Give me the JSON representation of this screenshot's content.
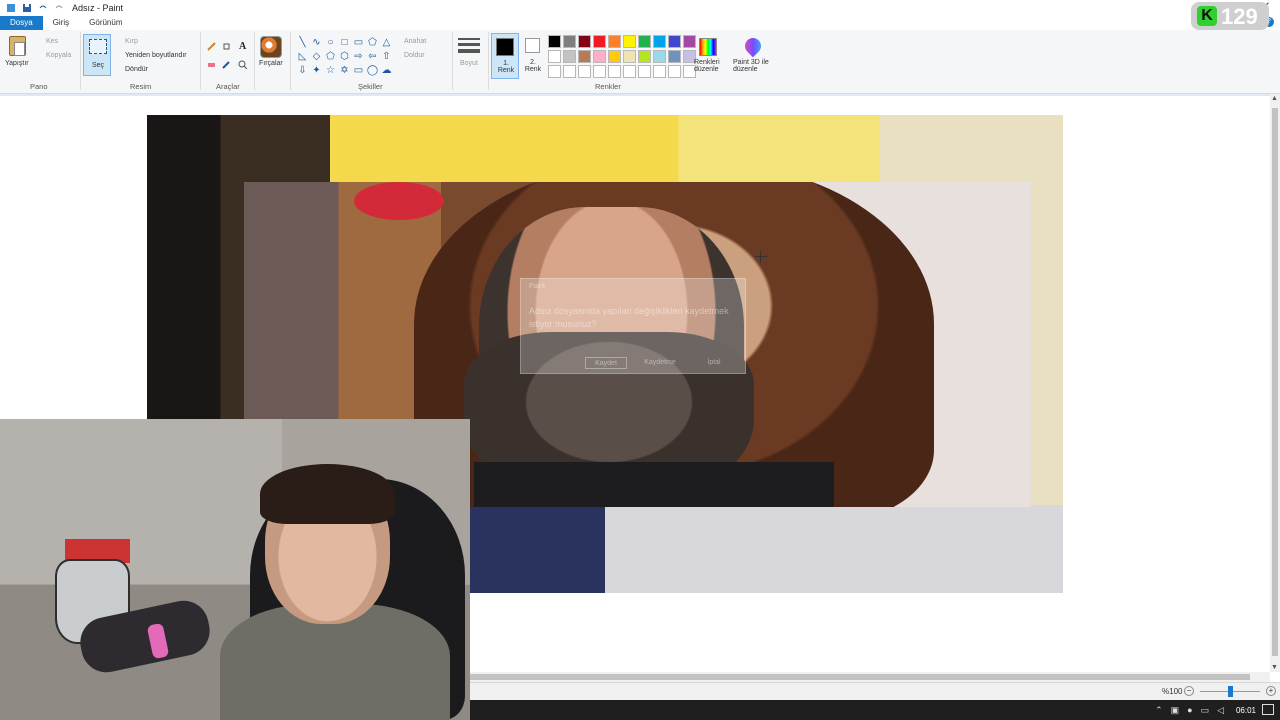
{
  "window": {
    "title": "Adsız - Paint"
  },
  "tabs": [
    {
      "label": "Dosya",
      "active": true
    },
    {
      "label": "Giriş",
      "active": false
    },
    {
      "label": "Görünüm",
      "active": false
    }
  ],
  "ribbon": {
    "clipboard": {
      "paste": "Yapıştır",
      "cut": "Kes",
      "copy": "Kopyala",
      "group": "Pano"
    },
    "image": {
      "select": "Seç",
      "crop": "Kırp",
      "resize": "Yeniden boyutlandır",
      "rotate": "Döndür",
      "group": "Resim"
    },
    "tools": {
      "group": "Araçlar"
    },
    "brushes": {
      "label": "Fırçalar"
    },
    "shapes": {
      "outline": "Anahat",
      "fill": "Doldur",
      "group": "Şekiller"
    },
    "size": {
      "label": "Boyut"
    },
    "colors": {
      "color1": "1. Renk",
      "color2": "2. Renk",
      "edit": "Renkleri düzenle",
      "paint3d": "Paint 3D ile düzenle",
      "group": "Renkler"
    }
  },
  "palette": {
    "row1": [
      "#000000",
      "#7f7f7f",
      "#880015",
      "#ed1c24",
      "#ff7f27",
      "#fff200",
      "#22b14c",
      "#00a2e8",
      "#3f48cc",
      "#a349a4"
    ],
    "row2": [
      "#ffffff",
      "#c3c3c3",
      "#b97a57",
      "#ffaec9",
      "#ffc90e",
      "#efe4b0",
      "#b5e61d",
      "#99d9ea",
      "#7092be",
      "#c8bfe7"
    ],
    "row3": [
      "#ffffff",
      "#ffffff",
      "#ffffff",
      "#ffffff",
      "#ffffff",
      "#ffffff",
      "#ffffff",
      "#ffffff",
      "#ffffff",
      "#ffffff"
    ]
  },
  "dialog": {
    "title": "Paint",
    "message": "Adsız dosyasında yapılan değişiklikleri kaydetmek istiyor musunuz?",
    "buttons": {
      "save": "Kaydet",
      "dont_save": "Kaydetme",
      "cancel": "İptal"
    }
  },
  "statusbar": {
    "zoom": "%100"
  },
  "taskbar": {
    "time": "06:01"
  },
  "overlay": {
    "counter": "129"
  }
}
